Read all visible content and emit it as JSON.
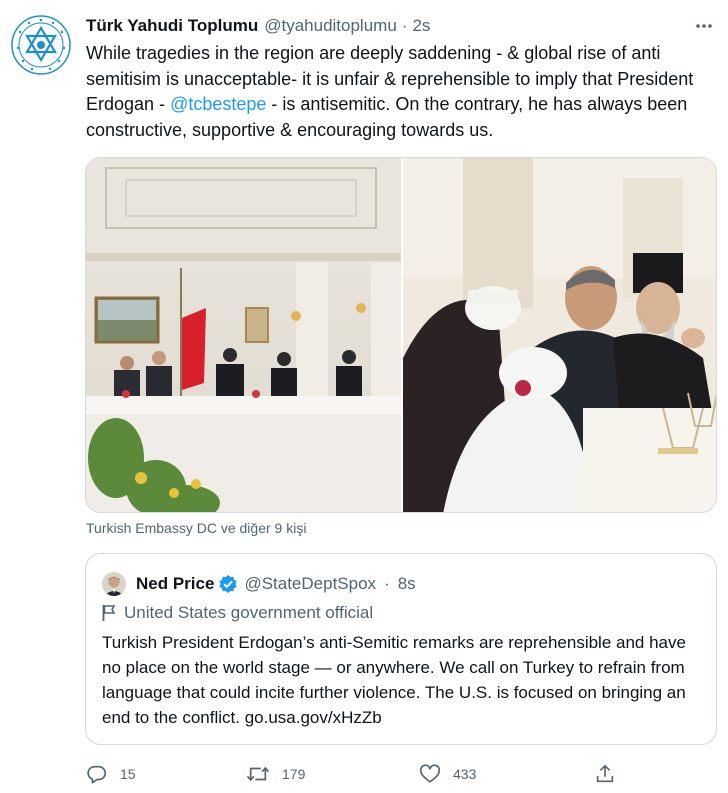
{
  "author": {
    "name": "Türk Yahudi Toplumu",
    "handle": "@tyahuditoplumu",
    "separator": "·",
    "time": "2s",
    "avatar_icon": "star-of-david-seal-icon",
    "avatar_color": "#1d8fcf"
  },
  "tweet": {
    "text_before": "While tragedies in the region are deeply saddening - & global rise of anti semitisim is unacceptable- it is unfair & reprehensible to imply that President Erdogan - ",
    "mention": "@tcbestepe",
    "text_after": " - is antisemitic. On the contrary, he has always been constructive, supportive & encouraging towards us."
  },
  "media": {
    "left_description_icon": "photo-meeting-room",
    "right_description_icon": "photo-dinner-table"
  },
  "tagged": "Turkish Embassy DC ve diğer 9 kişi",
  "quote": {
    "name": "Ned Price",
    "verified_icon": "verified-badge-icon",
    "handle": "@StateDeptSpox",
    "separator": "·",
    "time": "8s",
    "label": "United States government official",
    "label_icon": "flag-icon",
    "text": "Turkish President Erdogan’s anti-Semitic remarks are reprehensible and have no place on the world stage — or anywhere. We call on Turkey to refrain from language that could incite further violence. The U.S. is focused on bringing an end to the conflict. go.usa.gov/xHzZb"
  },
  "actions": {
    "reply_count": "15",
    "retweet_count": "179",
    "like_count": "433"
  },
  "colors": {
    "accent": "#1d9bf0",
    "secondary_text": "#536471",
    "border": "#cfd9de"
  }
}
